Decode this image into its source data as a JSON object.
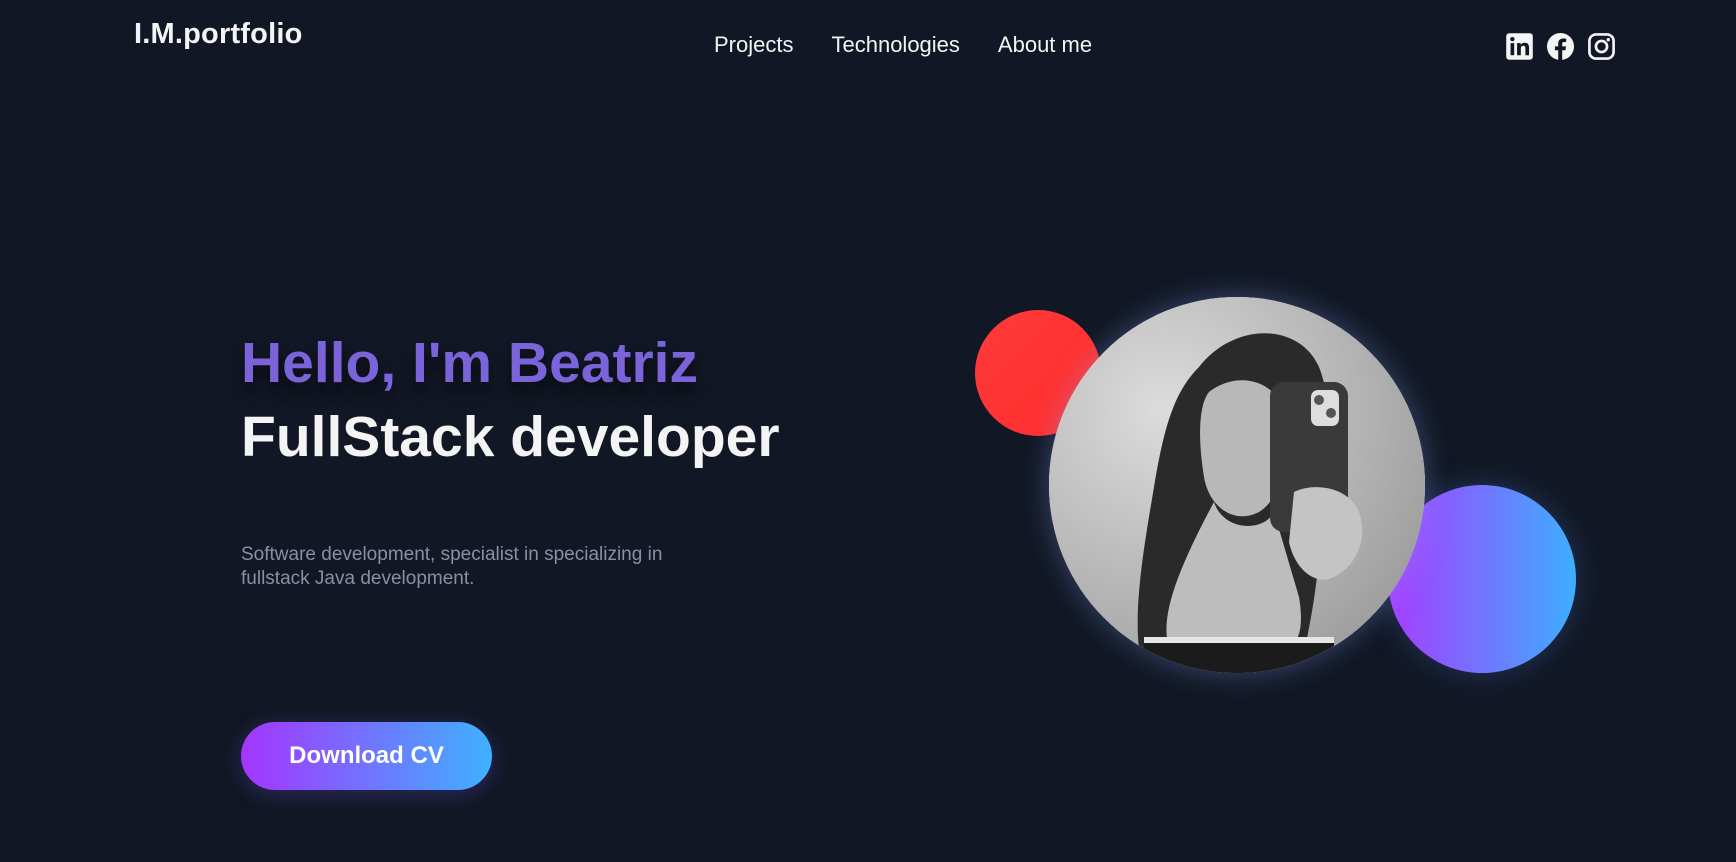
{
  "header": {
    "logo": "I.M.portfolio",
    "nav": [
      {
        "label": "Projects"
      },
      {
        "label": "Technologies"
      },
      {
        "label": "About me"
      }
    ],
    "social_icons": [
      "linkedin-icon",
      "facebook-icon",
      "instagram-icon"
    ]
  },
  "hero": {
    "greeting": "Hello, I'm Beatriz",
    "role": "FullStack developer",
    "description": "Software development, specialist in specializing in fullstack Java development.",
    "cta_label": "Download CV"
  },
  "colors": {
    "background": "#111724",
    "greeting_accent": "#7b63d9",
    "red_circle": "#ff3333",
    "gradient_start": "#a535ff",
    "gradient_end": "#3fb1ff"
  }
}
